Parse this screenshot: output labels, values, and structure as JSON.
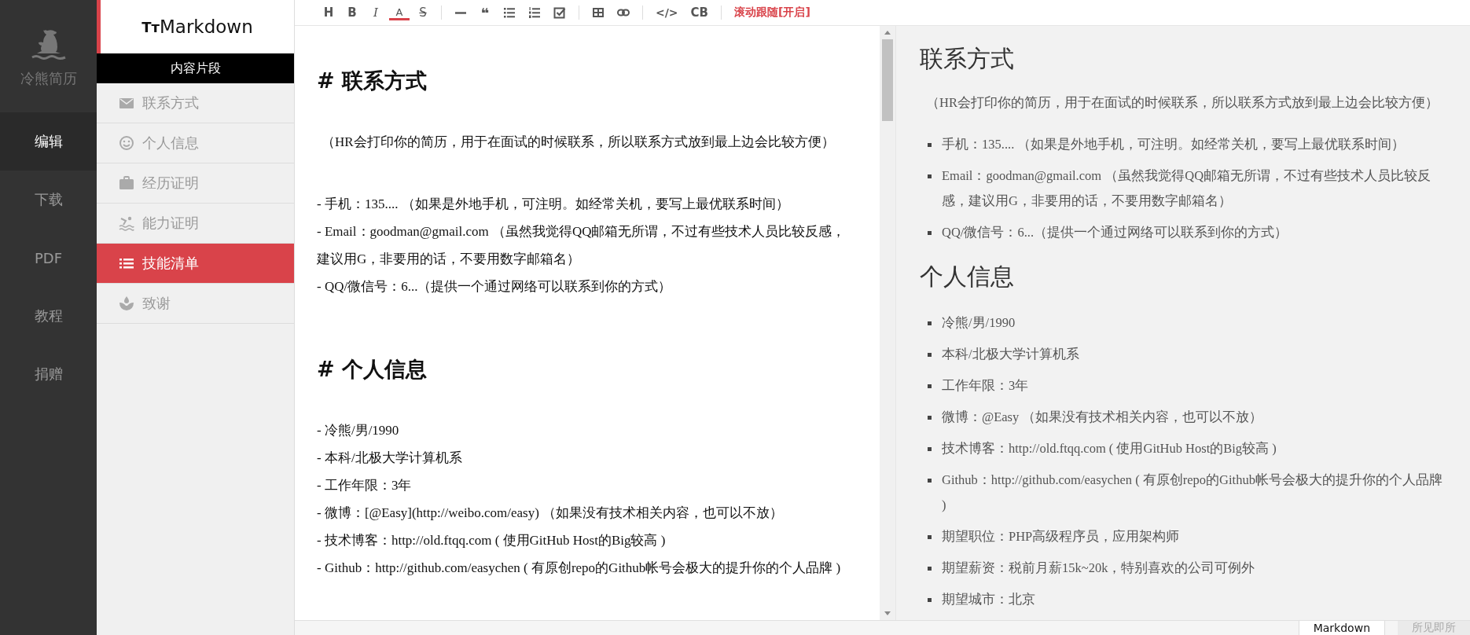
{
  "nav": {
    "logo_text": "冷熊简历",
    "items": [
      {
        "label": "编辑",
        "selected": true
      },
      {
        "label": "下载",
        "selected": false
      },
      {
        "label": "PDF",
        "selected": false
      },
      {
        "label": "教程",
        "selected": false
      },
      {
        "label": "捐赠",
        "selected": false
      }
    ]
  },
  "snippets": {
    "brand_mark": "Tᴛ",
    "brand_name": "Markdown",
    "title": "内容片段",
    "items": [
      {
        "label": "联系方式",
        "selected": false
      },
      {
        "label": "个人信息",
        "selected": false
      },
      {
        "label": "经历证明",
        "selected": false
      },
      {
        "label": "能力证明",
        "selected": false
      },
      {
        "label": "技能清单",
        "selected": true
      },
      {
        "label": "致谢",
        "selected": false
      }
    ]
  },
  "toolbar": {
    "groups": [
      [
        {
          "kind": "heading",
          "label": "H"
        },
        {
          "kind": "bold",
          "label": "B"
        },
        {
          "kind": "italic",
          "label": "I"
        },
        {
          "kind": "color",
          "label": "A"
        },
        {
          "kind": "strike",
          "label": "S"
        }
      ],
      [
        {
          "kind": "rule"
        },
        {
          "kind": "quote",
          "label": "❝"
        },
        {
          "kind": "ul"
        },
        {
          "kind": "ol"
        },
        {
          "kind": "task"
        }
      ],
      [
        {
          "kind": "table"
        },
        {
          "kind": "link"
        }
      ],
      [
        {
          "kind": "code",
          "label": "</>"
        },
        {
          "kind": "codeblock",
          "label": "CB"
        }
      ],
      [
        {
          "kind": "toggle",
          "label": "滚动跟随[开启]"
        }
      ]
    ]
  },
  "editor": {
    "blocks": [
      {
        "kind": "heading",
        "text": "# 联系方式"
      },
      {
        "kind": "para",
        "text": "（HR会打印你的简历，用于在面试的时候联系，所以联系方式放到最上边会比较方便）"
      },
      {
        "kind": "lines",
        "lines": [
          "- 手机：135.... （如果是外地手机，可注明。如经常关机，要写上最优联系时间）",
          "- Email：goodman@gmail.com （虽然我觉得QQ邮箱无所谓，不过有些技术人员比较反感，建议用G，非要用的话，不要用数字邮箱名）",
          "- QQ/微信号：6...（提供一个通过网络可以联系到你的方式）"
        ]
      },
      {
        "kind": "heading",
        "text": "# 个人信息"
      },
      {
        "kind": "lines",
        "lines": [
          "- 冷熊/男/1990",
          "- 本科/北极大学计算机系",
          "- 工作年限：3年",
          "- 微博：[@Easy](http://weibo.com/easy) （如果没有技术相关内容，也可以不放）",
          "- 技术博客：http://old.ftqq.com ( 使用GitHub Host的Big较高 )",
          "- Github：http://github.com/easychen ( 有原创repo的Github帐号会极大的提升你的个人品牌 )"
        ]
      }
    ]
  },
  "preview": {
    "blocks": [
      {
        "kind": "heading",
        "text": "联系方式"
      },
      {
        "kind": "para",
        "text": "（HR会打印你的简历，用于在面试的时候联系，所以联系方式放到最上边会比较方便）"
      },
      {
        "kind": "list",
        "items": [
          "手机：135.... （如果是外地手机，可注明。如经常关机，要写上最优联系时间）",
          "Email：goodman@gmail.com （虽然我觉得QQ邮箱无所谓，不过有些技术人员比较反感，建议用G，非要用的话，不要用数字邮箱名）",
          "QQ/微信号：6...（提供一个通过网络可以联系到你的方式）"
        ]
      },
      {
        "kind": "heading",
        "text": "个人信息"
      },
      {
        "kind": "list",
        "items": [
          "冷熊/男/1990",
          "本科/北极大学计算机系",
          "工作年限：3年",
          "微博：@Easy （如果没有技术相关内容，也可以不放）",
          "技术博客：http://old.ftqq.com ( 使用GitHub Host的Big较高 )",
          "Github：http://github.com/easychen ( 有原创repo的Github帐号会极大的提升你的个人品牌 )",
          "期望职位：PHP高级程序员，应用架构师",
          "期望薪资：税前月薪15k~20k，特别喜欢的公司可例外",
          "期望城市：北京"
        ]
      }
    ]
  },
  "bottom_tabs": [
    {
      "label": "Markdown",
      "selected": true
    },
    {
      "label": "所见即所",
      "selected": false
    }
  ]
}
